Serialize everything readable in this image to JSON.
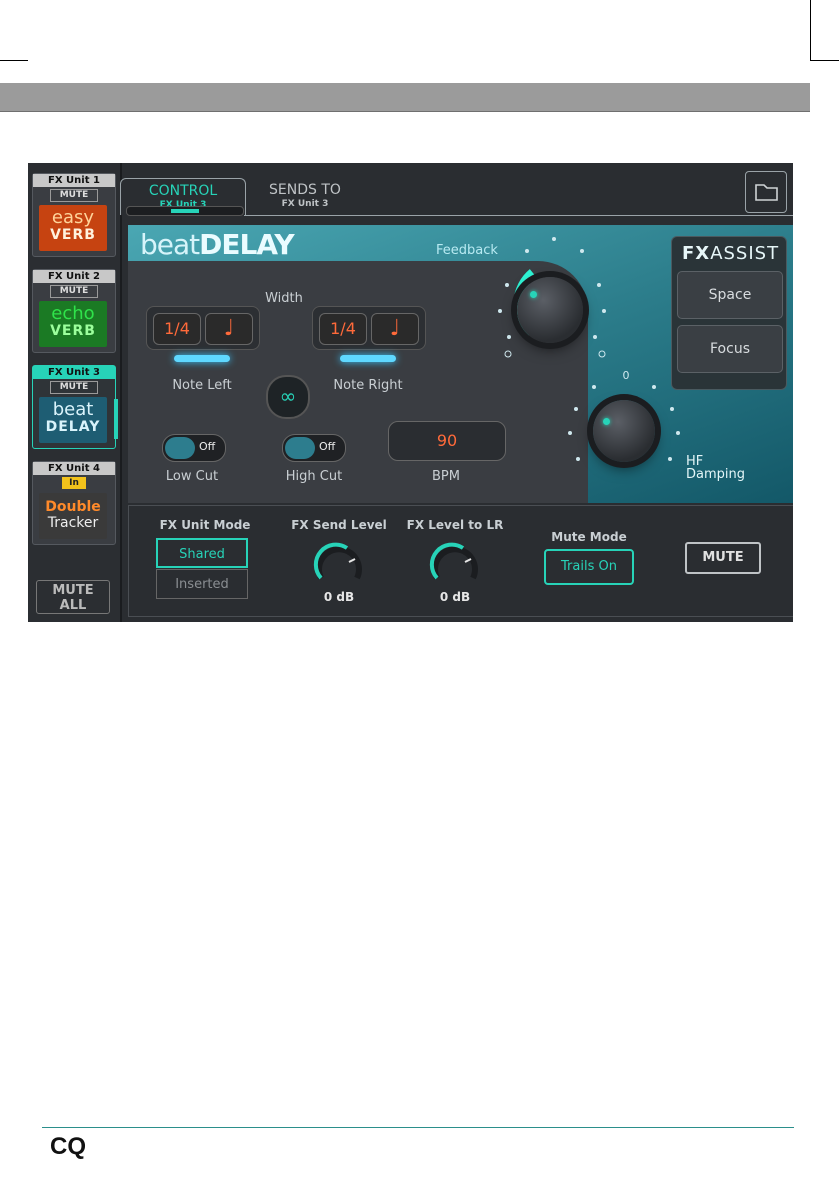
{
  "page": {
    "footer_logo": "CQ"
  },
  "sidebar": {
    "units": [
      {
        "title": "FX Unit 1",
        "badge": "MUTE",
        "logo_line1": "easy",
        "logo_line2": "VERB"
      },
      {
        "title": "FX Unit 2",
        "badge": "MUTE",
        "logo_line1": "echo",
        "logo_line2": "VERB"
      },
      {
        "title": "FX Unit 3",
        "badge": "MUTE",
        "logo_line1": "beat",
        "logo_line2": "DELAY"
      },
      {
        "title": "FX Unit 4",
        "badge": "In",
        "logo_line1": "Double",
        "logo_line2": "Tracker"
      }
    ],
    "mute_all_line1": "MUTE",
    "mute_all_line2": "ALL"
  },
  "tabs": [
    {
      "label": "CONTROL",
      "sub": "FX Unit 3",
      "active": true
    },
    {
      "label": "SENDS TO",
      "sub": "FX Unit 3",
      "active": false
    }
  ],
  "effect": {
    "logo_light": "beat",
    "logo_bold": "DELAY",
    "width_label": "Width",
    "note_left": {
      "value": "1/4",
      "glyph": "♩",
      "label": "Note Left"
    },
    "note_right": {
      "value": "1/4",
      "glyph": "♩",
      "label": "Note Right"
    },
    "low_cut": {
      "label": "Low Cut",
      "state": "Off"
    },
    "high_cut": {
      "label": "High Cut",
      "state": "Off"
    },
    "bpm": {
      "value": "90",
      "label": "BPM"
    },
    "feedback_label": "Feedback",
    "hf_damping_label": "HF Damping",
    "hf_scale_top": "0"
  },
  "fx_assist": {
    "title_bold": "FX",
    "title_light": "ASSIST",
    "buttons": [
      "Space",
      "Focus"
    ]
  },
  "bottom": {
    "mode_label": "FX Unit Mode",
    "mode_options": [
      "Shared",
      "Inserted"
    ],
    "send_label": "FX Send Level",
    "send_value": "0 dB",
    "lr_label": "FX Level to LR",
    "lr_value": "0 dB",
    "mute_mode_label": "Mute Mode",
    "mute_mode_value": "Trails On",
    "mute_label": "MUTE"
  },
  "colors": {
    "accent": "#27d3b8",
    "value_red": "#ff6a3a",
    "panel_teal": "#2c7d8b"
  }
}
